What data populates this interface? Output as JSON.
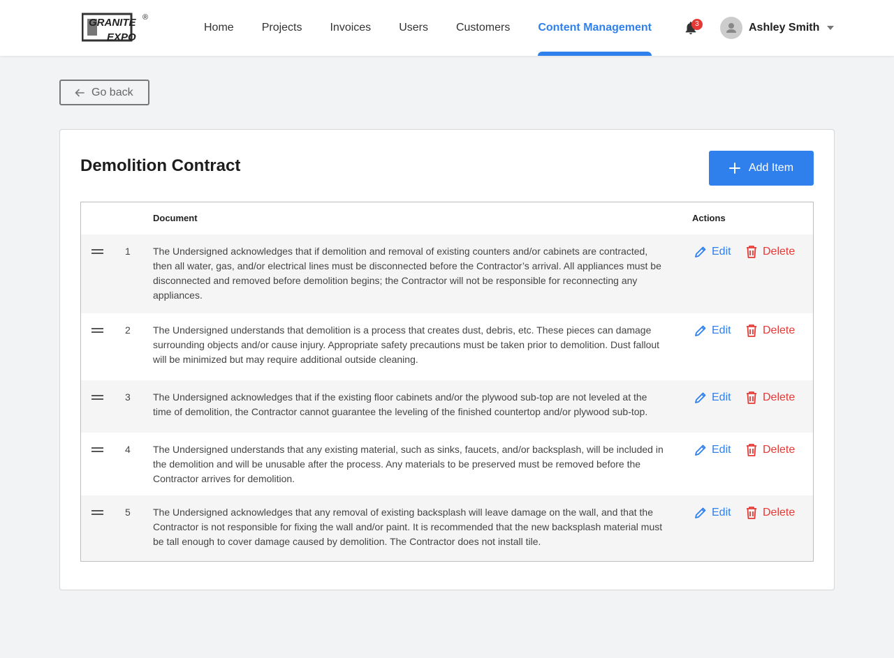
{
  "brand": {
    "logo_top": "GRANITE",
    "logo_bottom": "EXPO",
    "logo_mark": "®"
  },
  "nav": [
    {
      "label": "Home",
      "active": false
    },
    {
      "label": "Projects",
      "active": false
    },
    {
      "label": "Invoices",
      "active": false
    },
    {
      "label": "Users",
      "active": false
    },
    {
      "label": "Customers",
      "active": false
    },
    {
      "label": "Content Management",
      "active": true
    }
  ],
  "notifications": {
    "count": "3",
    "icon": "bell-icon"
  },
  "user": {
    "name": "Ashley Smith"
  },
  "go_back": {
    "label": "Go back"
  },
  "page": {
    "title": "Demolition Contract",
    "add_label": "Add Item",
    "columns": {
      "document": "Document",
      "actions": "Actions"
    },
    "edit_label": "Edit",
    "delete_label": "Delete"
  },
  "items": [
    {
      "num": "1",
      "text": "The Undersigned acknowledges that if demolition and removal of existing counters and/or cabinets are contracted, then all water, gas, and/or electrical lines must be disconnected before the Contractor’s arrival. All appliances must be disconnected and removed before demolition begins; the Contractor will not be responsible for reconnecting any appliances."
    },
    {
      "num": "2",
      "text": "The Undersigned understands that demolition is a process that creates dust, debris, etc. These pieces can damage surrounding objects and/or cause injury. Appropriate safety precautions must be taken prior to demolition. Dust fallout will be minimized but may require additional outside cleaning."
    },
    {
      "num": "3",
      "text": "The Undersigned acknowledges that if the existing floor cabinets and/or the plywood sub-top are not leveled at the time of demolition, the Contractor cannot guarantee the leveling of the finished countertop and/or plywood sub-top."
    },
    {
      "num": "4",
      "text": "The Undersigned understands that any existing material, such as sinks, faucets, and/or backsplash, will be included in the demolition and will be unusable after the process. Any materials to be preserved must be removed before the Contractor arrives for demolition."
    },
    {
      "num": "5",
      "text": "The Undersigned acknowledges that any removal of existing backsplash will leave damage on the wall, and that the Contractor is not responsible for fixing the wall and/or paint. It is recommended that the new backsplash material must be tall enough to cover damage caused by demolition. The Contractor does not install tile."
    }
  ],
  "colors": {
    "accent": "#2f80ed",
    "danger": "#e53935",
    "row_shade": "#f5f5f5"
  }
}
